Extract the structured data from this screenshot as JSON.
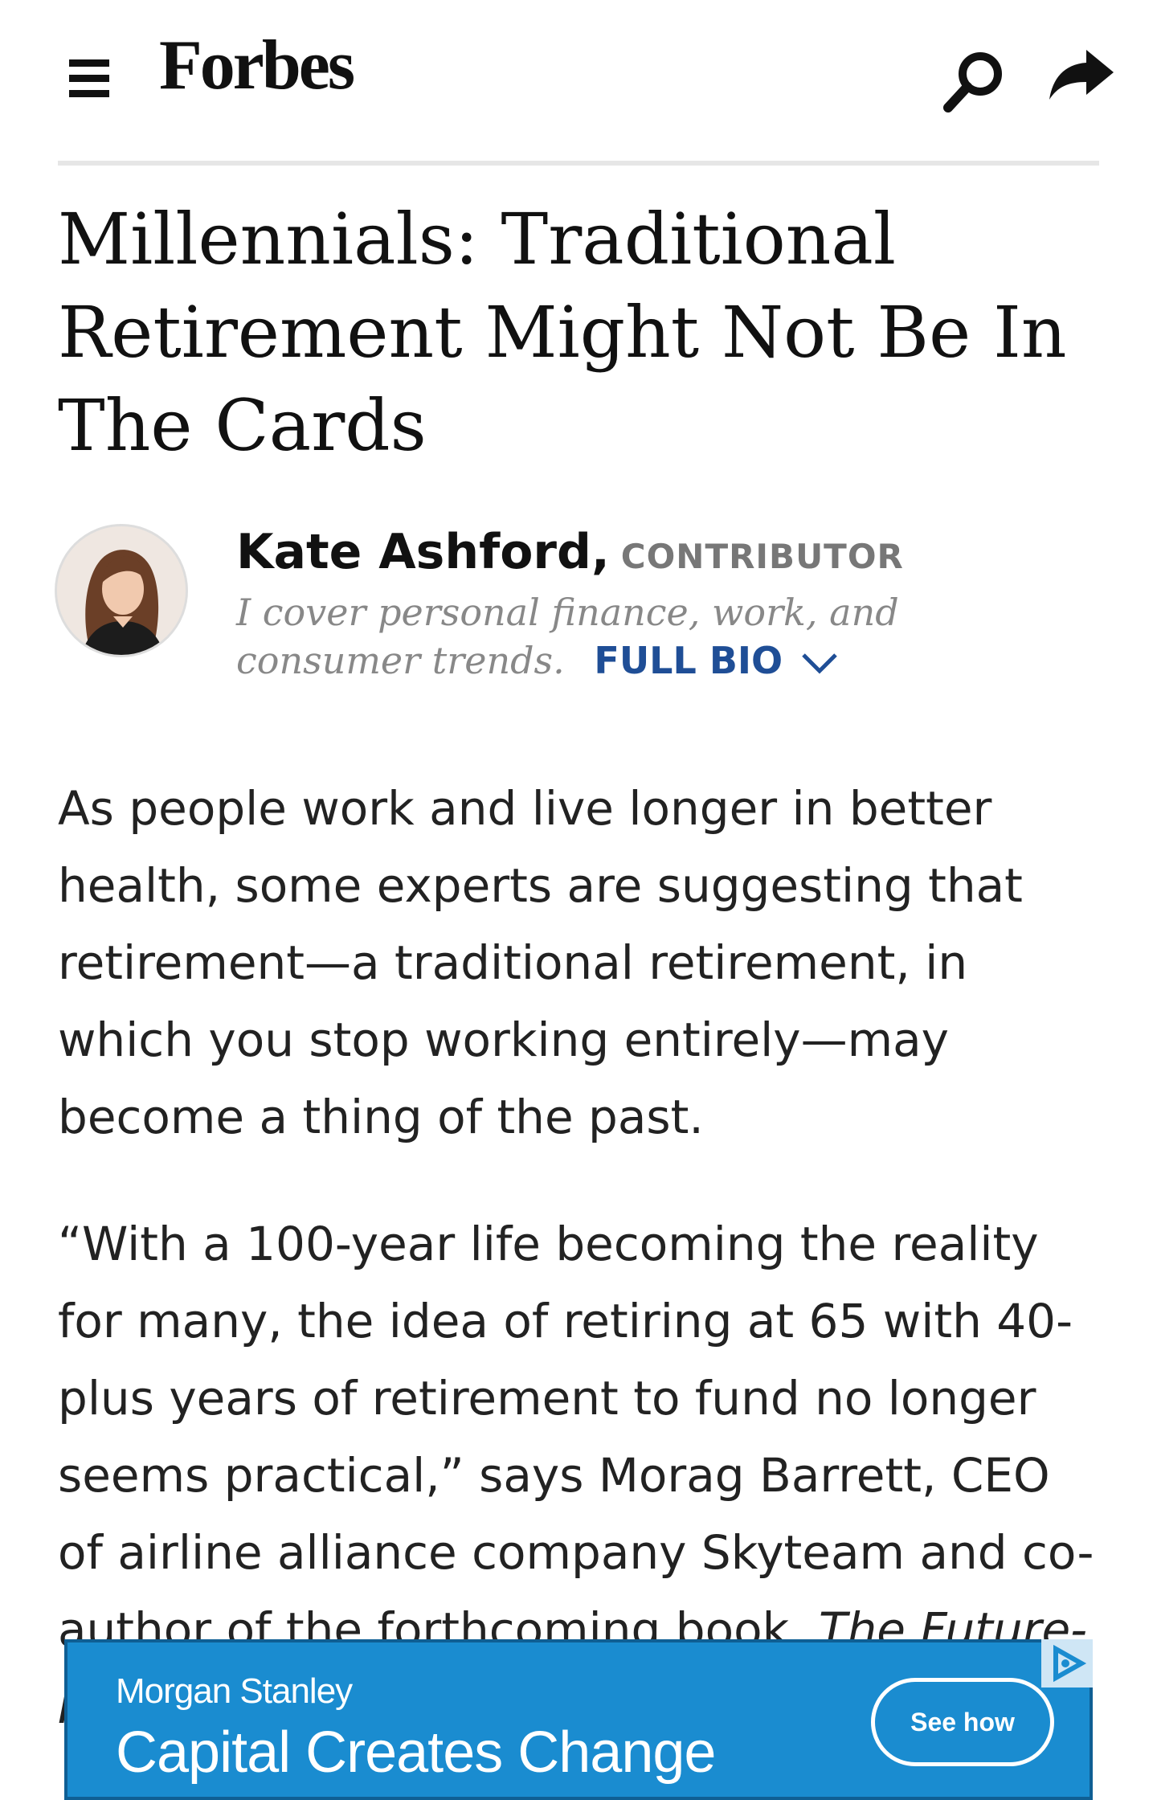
{
  "header": {
    "logo": "Forbes",
    "icons": {
      "menu": "hamburger-menu-icon",
      "search": "search-icon",
      "share": "share-icon"
    }
  },
  "article": {
    "headline": "Millennials: Traditional Retirement Might Not Be In The Cards",
    "author": {
      "name": "Kate Ashford,",
      "role": "CONTRIBUTOR",
      "bio": "I cover personal finance, work, and consumer trends.",
      "full_bio_label": "FULL BIO"
    },
    "paragraphs": [
      "As people work and live longer in better health, some experts are suggesting that retirement—a traditional retirement, in which you stop working entirely—may become a thing of the past.",
      "“With a 100-year life becoming the reality for many, the idea of retiring at 65 with 40-plus years of retirement to fund no longer seems practical,” says Morag Barrett, CEO of airline alliance company Skyteam and co-author of the forthcoming book, "
    ],
    "book_title": "The Future-Proof"
  },
  "ad": {
    "brand": "Morgan Stanley",
    "tagline": "Capital Creates Change",
    "button": "See how"
  },
  "colors": {
    "link_blue": "#1f4e96",
    "ad_blue": "#1a8cd0",
    "role_gray": "#777777"
  }
}
